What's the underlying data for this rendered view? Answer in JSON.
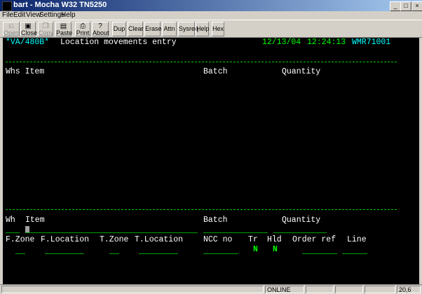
{
  "window": {
    "title": "bart - Mocha W32 TN5250",
    "minimize": "_",
    "maximize": "□",
    "close": "×"
  },
  "menu": [
    "File",
    "Edit",
    "View",
    "Settings",
    "Help"
  ],
  "toolbar": {
    "open": "Open",
    "close": "Close",
    "copy": "Copy",
    "paste": "Paste",
    "print": "Print",
    "about": "About",
    "dup": "Dup",
    "clear": "Clear",
    "erase": "Erase",
    "attn": "Attn",
    "sysreq": "Sysreq",
    "help": "Help",
    "hex": "Hex"
  },
  "screen": {
    "program": "*VA/480B*",
    "title": "Location movements entry",
    "date": "12/13/04",
    "time": "12:24:13",
    "workstation": "WMR71001",
    "list_headers": {
      "whs_item": "Whs Item",
      "batch": "Batch",
      "quantity": "Quantity"
    },
    "entry_labels": {
      "wh": "Wh",
      "item": "Item",
      "batch": "Batch",
      "quantity": "Quantity",
      "f_zone": "F.Zone",
      "f_location": "F.Location",
      "t_zone": "T.Zone",
      "t_location": "T.Location",
      "ncc_no": "NCC no",
      "tr": "Tr",
      "hld": "Hld",
      "order_ref": "Order ref",
      "line": "Line"
    },
    "tr_value": "N",
    "hld_value": "N"
  },
  "status": {
    "mode": "ONLINE",
    "cursor_pos": "20,6"
  },
  "colors": {
    "cyan": "#00ffff",
    "green": "#00ff00",
    "white": "#ffffff",
    "background": "#000000"
  }
}
